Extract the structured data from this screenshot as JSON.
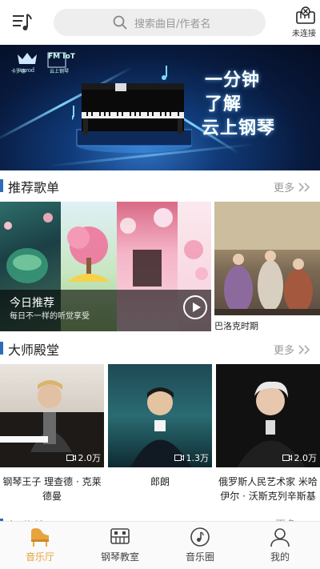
{
  "header": {
    "search_placeholder": "搜索曲目/作者名",
    "device_status": "未连接"
  },
  "banner": {
    "brand_left": "卡罗德",
    "brand_right": "云上钢琴",
    "logo_text_right": "FM IoT",
    "slogan": [
      "一分钟",
      "了解",
      "云上钢琴"
    ]
  },
  "recommend": {
    "title": "推荐歌单",
    "more": "更多",
    "today_title": "今日推荐",
    "today_subtitle": "每日不一样的听觉享受",
    "side_label": "巴洛克时期"
  },
  "masters": {
    "title": "大师殿堂",
    "more": "更多",
    "items": [
      {
        "name": "钢琴王子 理查德 · 克莱德曼",
        "views": "2.0万"
      },
      {
        "name": "郎朗",
        "views": "1.3万"
      },
      {
        "name": "俄罗斯人民艺术家 米哈伊尔 · 沃斯克列辛斯基",
        "views": "2.0万"
      }
    ]
  },
  "next_section": {
    "title": "新曲练习",
    "more": "更多"
  },
  "tabs": [
    {
      "label": "音乐厅",
      "active": true
    },
    {
      "label": "钢琴教室",
      "active": false
    },
    {
      "label": "音乐圈",
      "active": false
    },
    {
      "label": "我的",
      "active": false
    }
  ],
  "colors": {
    "accent": "#e8a33d",
    "section_bar": "#2c6db5",
    "tab_inactive": "#444444"
  }
}
